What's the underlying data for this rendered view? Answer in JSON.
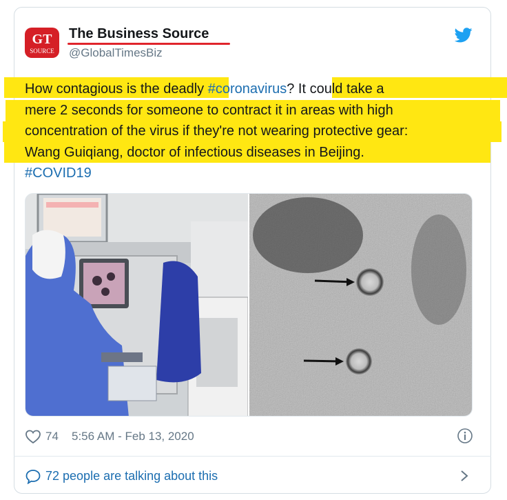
{
  "tweet": {
    "logo_text": {
      "top": "GT",
      "bottom": "SOURCE"
    },
    "display_name": "The Business Source",
    "handle": "@GlobalTimesBiz",
    "text_lines": [
      {
        "before": "How contagious is the deadly ",
        "hashtag": "#coronavirus",
        "after": "?  It could take a"
      },
      {
        "text": "mere 2 seconds for someone to contract it in areas with high"
      },
      {
        "text": "concentration of the virus if they're not wearing protective gear:"
      },
      {
        "text": "Wang Guiqiang, doctor of infectious diseases in Beijing."
      },
      {
        "hashtag": "#COVID19"
      }
    ],
    "likes": "74",
    "timestamp": "5:56 AM - Feb 13, 2020",
    "talking": "72 people are talking about this"
  },
  "colors": {
    "highlight": "#ffe712",
    "link": "#1b6db0",
    "twitter_blue": "#1da1f2",
    "underline_red": "#e0242b",
    "muted": "#657786"
  },
  "icons": [
    "twitter-bird-icon",
    "heart-icon",
    "info-icon",
    "speech-bubble-icon",
    "chevron-right-icon"
  ]
}
